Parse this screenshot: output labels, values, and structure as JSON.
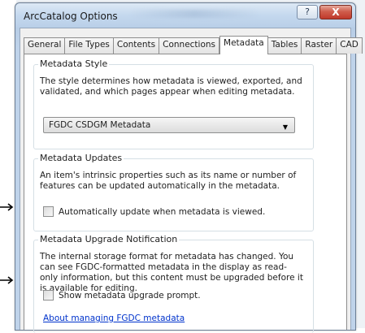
{
  "window": {
    "title": "ArcCatalog Options",
    "help_glyph": "?",
    "close_glyph": "X"
  },
  "tabs": [
    {
      "label": "General"
    },
    {
      "label": "File Types"
    },
    {
      "label": "Contents"
    },
    {
      "label": "Connections"
    },
    {
      "label": "Metadata",
      "active": true
    },
    {
      "label": "Tables"
    },
    {
      "label": "Raster"
    },
    {
      "label": "CAD"
    }
  ],
  "metadata_style": {
    "legend": "Metadata Style",
    "description": "The style determines how metadata is viewed, exported, and validated, and which pages appear when editing metadata.",
    "selected": "FGDC CSDGM Metadata"
  },
  "metadata_updates": {
    "legend": "Metadata Updates",
    "description": "An item's intrinsic properties such as its name or number of features can be updated automatically in the metadata.",
    "checkbox_label": "Automatically update when metadata is viewed.",
    "checked": false
  },
  "upgrade_notification": {
    "legend": "Metadata Upgrade Notification",
    "description": "The internal storage format for metadata has changed. You can see FGDC-formatted metadata in the display as read-only information, but this content must be upgraded before it is available for editing.",
    "checkbox_label": "Show metadata upgrade prompt.",
    "checked": false,
    "link": "About managing FGDC metadata"
  },
  "colors": {
    "link": "#0033cc",
    "close_button": "#c0392b",
    "arrow": "#000000"
  }
}
